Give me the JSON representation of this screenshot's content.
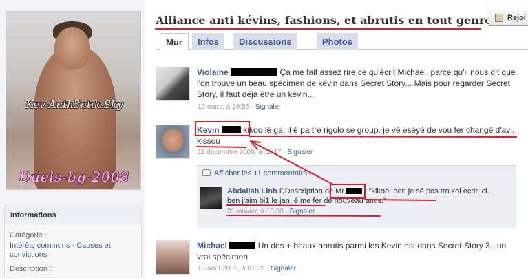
{
  "colors": {
    "link": "#3b5998",
    "annotation": "#e01b24",
    "tab_bg": "#d8dfea",
    "sidebar_bg": "#f2f4f8"
  },
  "profile": {
    "photo_caption_top": "Kev-Auth3ntik.Sky",
    "photo_caption_bottom": "Duels-bg-2008"
  },
  "info": {
    "title": "Informations",
    "category_label": "Catégorie :",
    "category_value": "Intérêts communs - Causes et convictions",
    "description_label": "Description :"
  },
  "group": {
    "title": "Alliance anti kévins, fashions, et abrutis en tout genre =D",
    "join_label": "Rejoi"
  },
  "tabs": [
    {
      "label": "Mur",
      "active": true
    },
    {
      "label": "Infos",
      "active": false
    },
    {
      "label": "Discussions",
      "active": false
    },
    {
      "label": "Photos",
      "active": false
    }
  ],
  "posts": [
    {
      "author": "Violaine",
      "text": "Ça me fait assez rire ce qu'écrit Michael, parce qu'il nous dit que l'on trouve un beau spécimen de kévin dans Secret Story... Mais pour regarder Secret Story, il faut déjà être un kévin...",
      "date": "19 mars, à 19:56",
      "separator": " · ",
      "report_label": "Signaler"
    },
    {
      "author": "Kevin",
      "text": "kikoo lé ga. il é pa tré rigolo se group. je vé éséyé de vou fer changé d'avi. kissou",
      "date": "11 décembre 2009, à 12:17",
      "separator": " · ",
      "report_label": "Signaler",
      "comments_toggle": "Afficher les 11 commentaires",
      "comment": {
        "author": "Abdallah Linh",
        "prefix": "DDescription de",
        "mr": "Mr.",
        "text_line1": ": \"kikoo. ben je sé pas tro koi ecrir ici.",
        "text_line2": "ben j'aim bi1 le jan, é me fer dé nouveau amis.\"",
        "date": "31 janvier, à 13:30",
        "separator": " · ",
        "report_label": "Signaler"
      }
    },
    {
      "author": "Michael",
      "text": "Un des + beaux abrutis parmi les Kevin est dans Secret Story 3.. un vrai spécimen",
      "date": "13 août 2009, à 01:39",
      "separator": " · ",
      "report_label": "Signaler"
    }
  ]
}
